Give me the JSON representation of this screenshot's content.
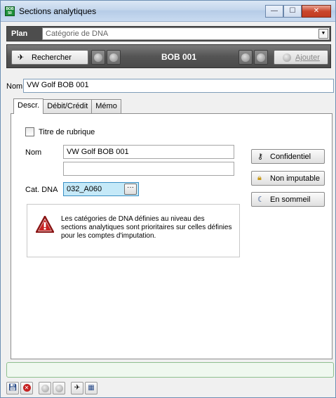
{
  "window": {
    "title": "Sections analytiques",
    "icon": "bob-app-icon",
    "controls": {
      "minimize": "—",
      "maximize": "☐",
      "close": "✕"
    }
  },
  "plan": {
    "label": "Plan",
    "selected": "Catégorie de DNA"
  },
  "toolbar": {
    "search_label": "Rechercher",
    "record": "BOB 001",
    "add_label": "Ajouter"
  },
  "header": {
    "name_label": "Nom",
    "name_value": "VW Golf BOB 001"
  },
  "tabs": [
    {
      "label": "Descr.",
      "active": true
    },
    {
      "label": "Débit/Crédit",
      "active": false
    },
    {
      "label": "Mémo",
      "active": false
    }
  ],
  "descr": {
    "heading_checkbox_label": "Titre de rubrique",
    "name_label": "Nom",
    "name_value": "VW Golf BOB 001",
    "name_value_2": "",
    "cat_label": "Cat. DNA",
    "cat_value": "032_A060",
    "ellipsis": "···"
  },
  "side_buttons": {
    "confidential": "Confidentiel",
    "non_imputable": "Non imputable",
    "dormant": "En sommeil"
  },
  "info": {
    "text": "Les catégories de DNA définies au niveau des sections analytiques sont prioritaires sur celles définies pour les comptes d'imputation."
  },
  "status": {
    "text": ""
  }
}
